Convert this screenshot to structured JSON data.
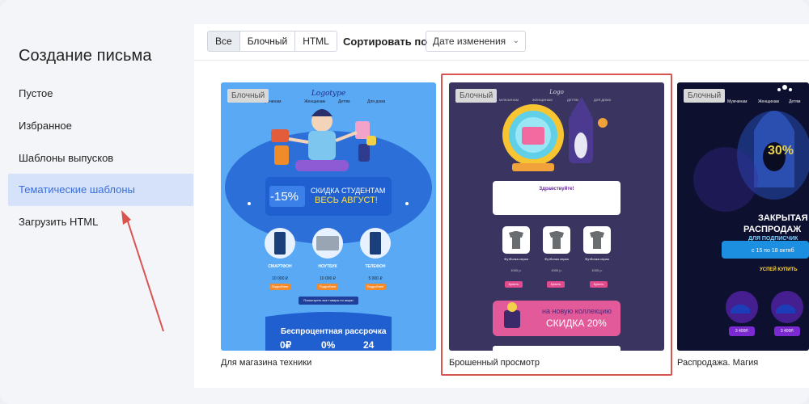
{
  "sidebar": {
    "title": "Создание письма",
    "items": [
      {
        "label": "Пустое"
      },
      {
        "label": "Избранное"
      },
      {
        "label": "Шаблоны выпусков"
      },
      {
        "label": "Тематические шаблоны"
      },
      {
        "label": "Загрузить HTML"
      }
    ]
  },
  "toolbar": {
    "filters": [
      "Все",
      "Блочный",
      "HTML"
    ],
    "sort_label": "Сортировать по",
    "sort_value": "Дате изменения"
  },
  "cards": [
    {
      "badge": "Блочный",
      "caption": "Для магазина техники",
      "preview": {
        "menu": [
          "Мужчинам",
          "Женщинам",
          "Детям",
          "Для дома"
        ],
        "discount": "-15%",
        "promo_line1": "СКИДКА СТУДЕНТАМ",
        "promo_line2": "ВЕСЬ АВГУСТ!",
        "products": [
          {
            "name": "СМАРТФОН",
            "price": "10 000 ₽",
            "btn": "Подробнее"
          },
          {
            "name": "НОУТБУК",
            "price": "10 000 ₽",
            "btn": "Подробнее"
          },
          {
            "name": "ТЕЛЕФОН",
            "price": "5 000 ₽",
            "btn": "Подробнее"
          }
        ],
        "cta": "Посмотреть все товары по акции",
        "installment": "Беспроцентная рассрочка",
        "stats": [
          "0₽",
          "0%",
          "24"
        ]
      }
    },
    {
      "badge": "Блочный",
      "caption": "Брошенный просмотр",
      "preview": {
        "menu": [
          "МУЖЧИНАМ",
          "ЖЕНЩИНАМ",
          "ДЕТЯМ",
          "ДЛЯ ДОМА"
        ],
        "greeting": "Здравствуйте!",
        "products": [
          {
            "name": "Футболка серая",
            "price": "1000 р.",
            "btn": "Купить"
          },
          {
            "name": "Футболка серая",
            "price": "1000 р.",
            "btn": "Купить"
          },
          {
            "name": "Футболка серая",
            "price": "1000 р.",
            "btn": "Купить"
          }
        ],
        "banner_line1": "на новую коллекцию",
        "banner_line2": "СКИДКА 20%"
      }
    },
    {
      "badge": "Блочный",
      "caption": "Распродажа. Магия",
      "preview": {
        "menu": [
          "Мужчинам",
          "Женщинам",
          "Детям"
        ],
        "percent": "30%",
        "headline1": "ЗАКРЫТАЯ",
        "headline2": "РАСПРОДАЖ",
        "sub": "ДЛЯ ПОДПИСЧИК",
        "dates": "с 15 по 18 октяб",
        "cta": "УСПЕЙ КУПИТЬ",
        "prices": [
          "3 400Р.",
          "3 400Р."
        ]
      }
    }
  ],
  "colors": {
    "accent": "#3a6fd8",
    "active_bg": "#d6e2fa",
    "highlight": "#d9534f"
  }
}
